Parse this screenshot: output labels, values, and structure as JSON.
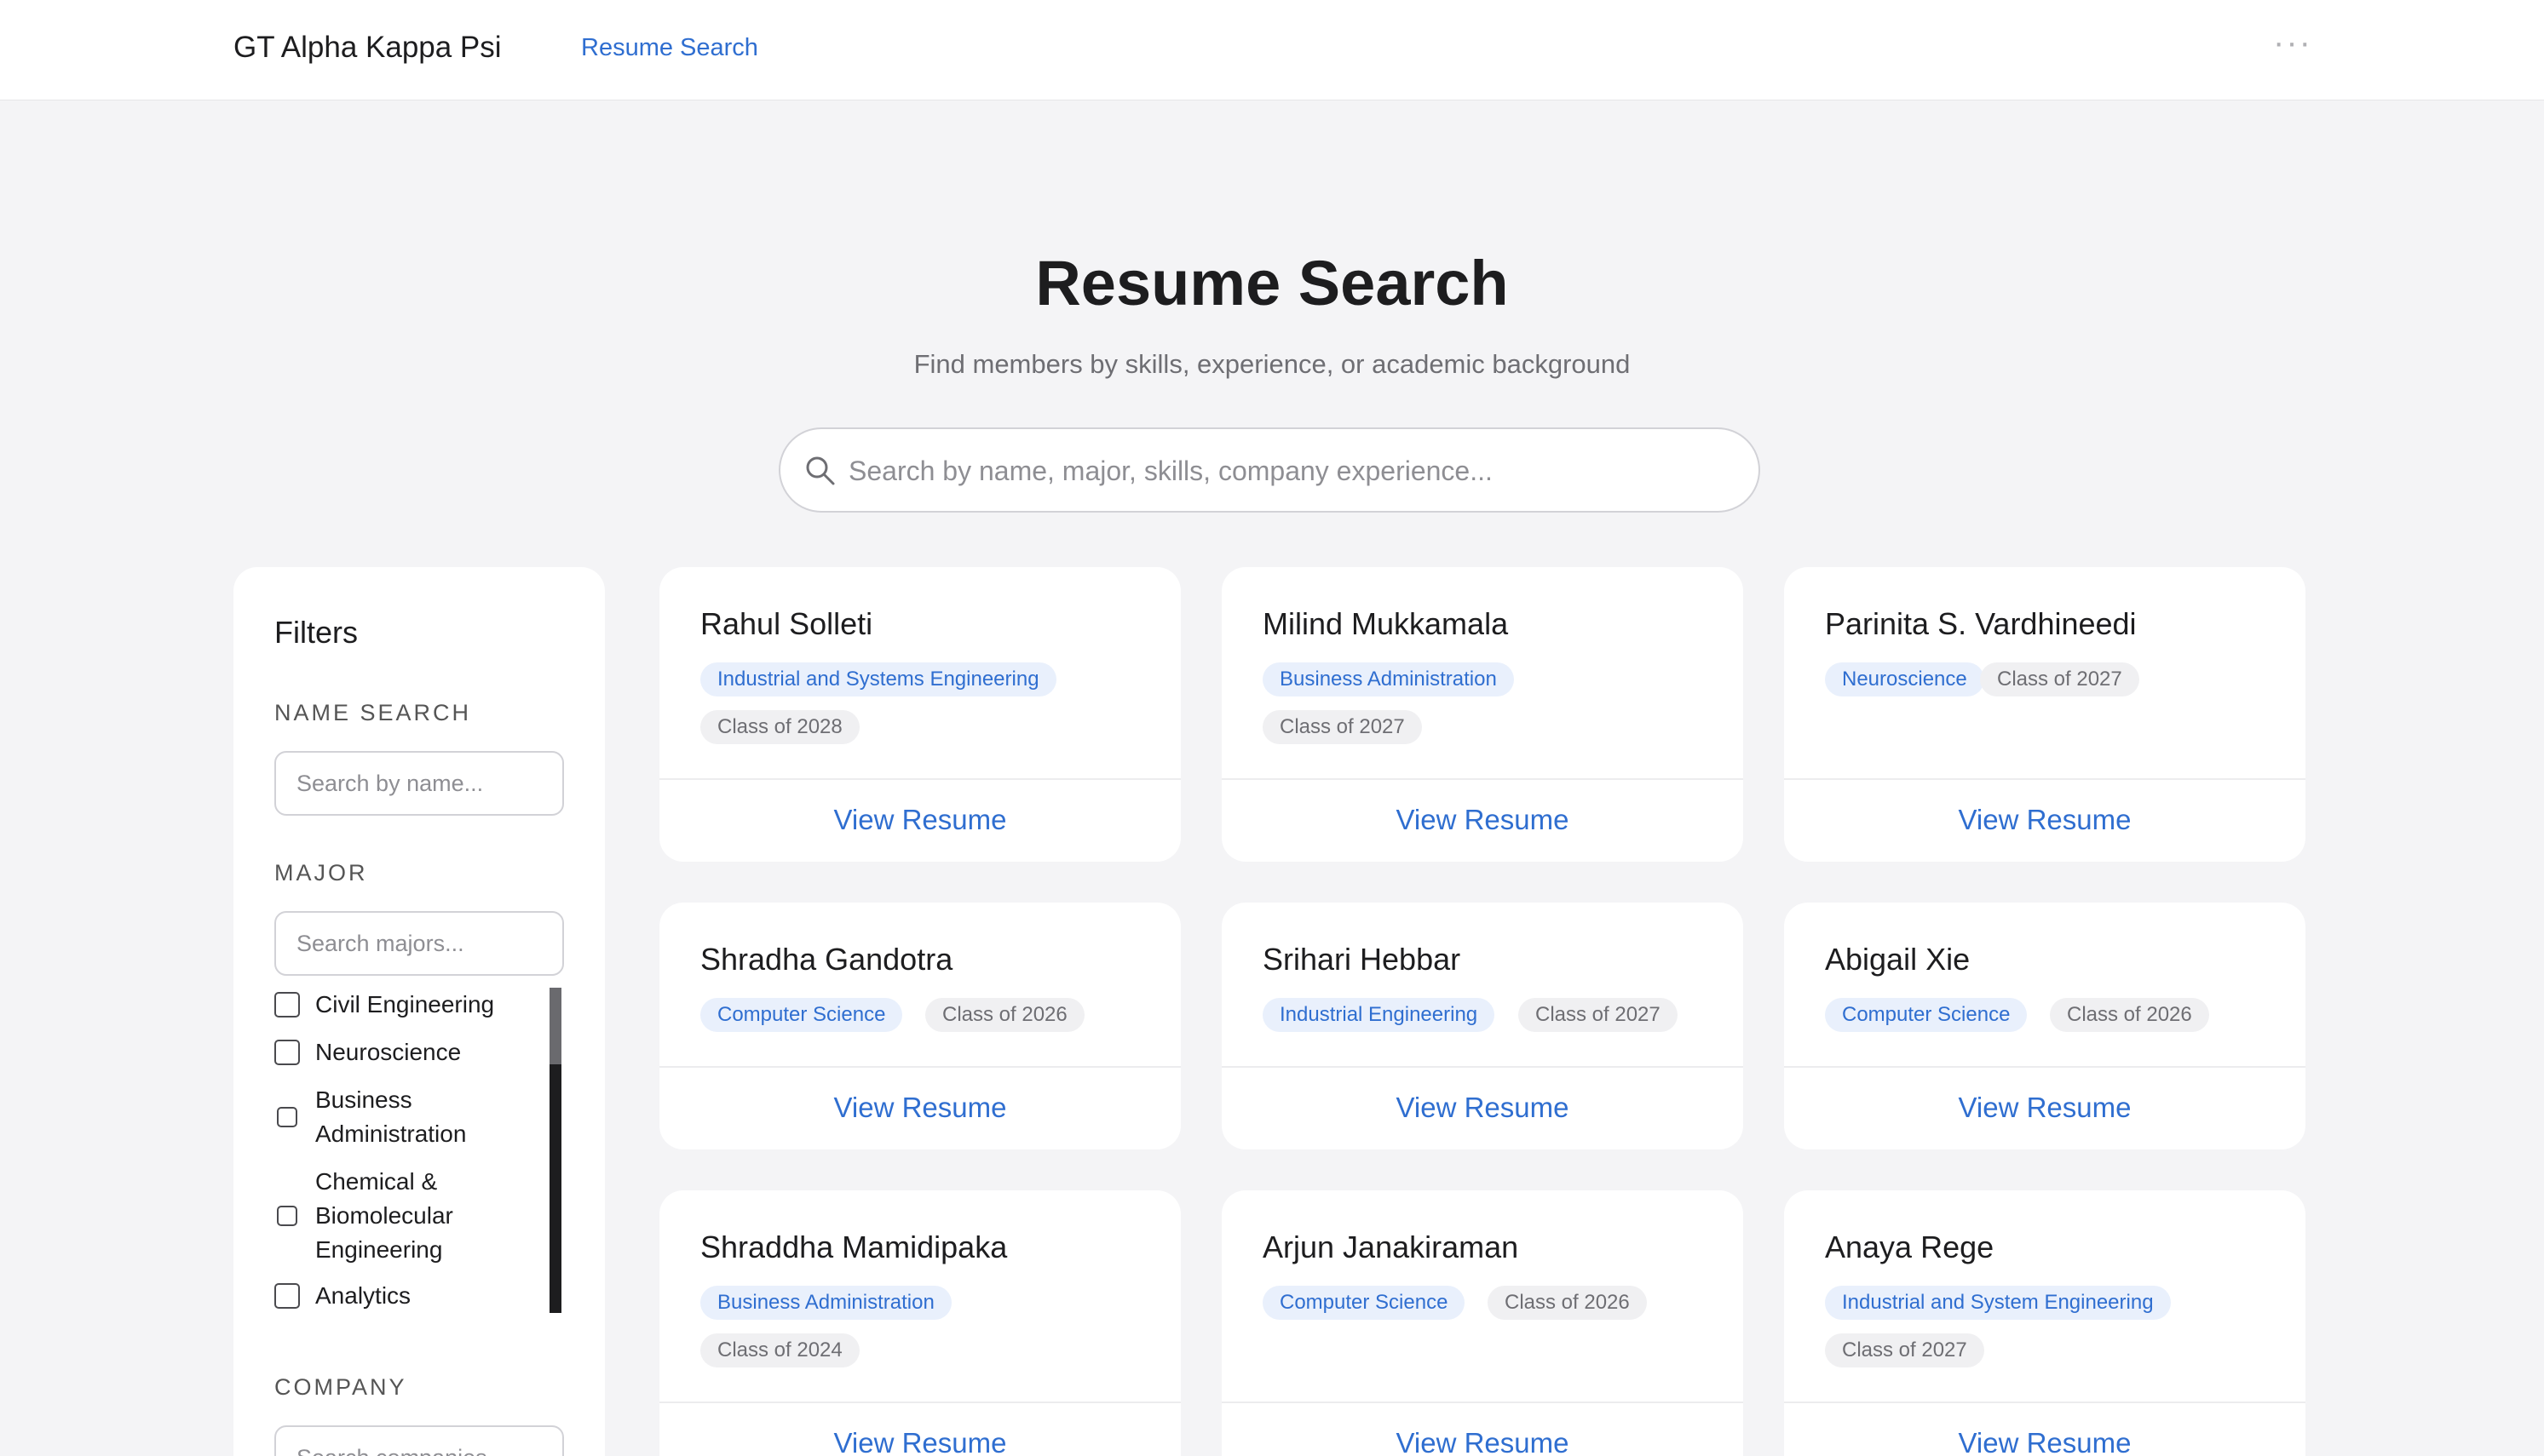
{
  "nav": {
    "brand": "GT Alpha Kappa Psi",
    "link_resume_search": "Resume Search",
    "more": "···"
  },
  "hero": {
    "title": "Resume Search",
    "subtitle": "Find members by skills, experience, or academic background",
    "search_placeholder": "Search by name, major, skills, company experience..."
  },
  "filters": {
    "title": "Filters",
    "name_search_label": "NAME SEARCH",
    "name_search_placeholder": "Search by name...",
    "major_label": "MAJOR",
    "major_search_placeholder": "Search majors...",
    "majors": [
      "Civil Engineering",
      "Neuroscience",
      "Business Administration",
      "Chemical & Biomolecular Engineering",
      "Analytics"
    ],
    "company_label": "COMPANY",
    "company_search_placeholder": "Search companies..."
  },
  "members": [
    {
      "name": "Rahul Solleti",
      "major": "Industrial and Systems Engineering",
      "class": "Class of 2028",
      "action": "View Resume"
    },
    {
      "name": "Milind Mukkamala",
      "major": "Business Administration",
      "class": "Class of 2027",
      "action": "View Resume"
    },
    {
      "name": "Parinita S. Vardhineedi",
      "major": "Neuroscience",
      "class": "Class of 2027",
      "action": "View Resume"
    },
    {
      "name": "Shradha Gandotra",
      "major": "Computer Science",
      "class": "Class of 2026",
      "action": "View Resume"
    },
    {
      "name": "Srihari Hebbar",
      "major": "Industrial Engineering",
      "class": "Class of 2027",
      "action": "View Resume"
    },
    {
      "name": "Abigail Xie",
      "major": "Computer Science",
      "class": "Class of 2026",
      "action": "View Resume"
    },
    {
      "name": "Shraddha Mamidipaka",
      "major": "Business Administration",
      "class": "Class of 2024",
      "action": "View Resume"
    },
    {
      "name": "Arjun Janakiraman",
      "major": "Computer Science",
      "class": "Class of 2026",
      "action": "View Resume"
    },
    {
      "name": "Anaya Rege",
      "major": "Industrial and System Engineering",
      "class": "Class of 2027",
      "action": "View Resume"
    }
  ],
  "colors": {
    "accent": "#2f6ed0",
    "background": "#f4f4f6",
    "major_tag_bg": "#e9f0fc",
    "class_tag_bg": "#f0f0f2"
  }
}
